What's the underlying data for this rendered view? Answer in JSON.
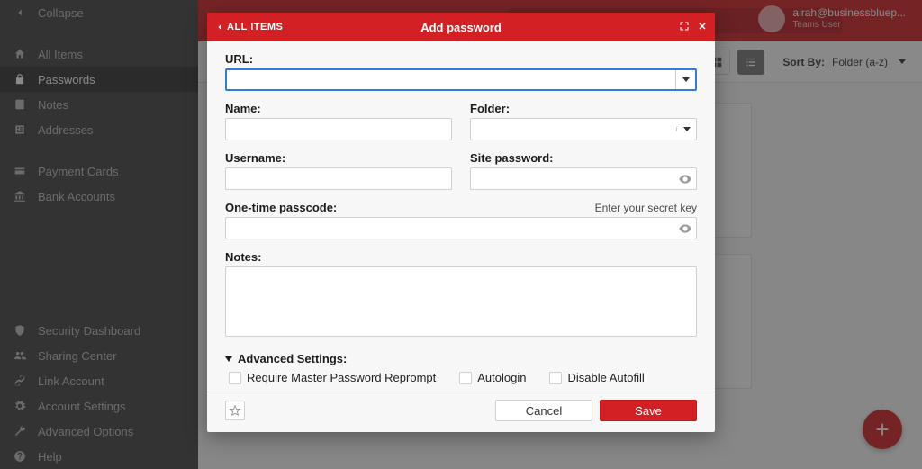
{
  "sidebar": {
    "collapse": "Collapse",
    "items": [
      {
        "label": "All Items"
      },
      {
        "label": "Passwords"
      },
      {
        "label": "Notes"
      },
      {
        "label": "Addresses"
      }
    ],
    "payment": [
      {
        "label": "Payment Cards"
      },
      {
        "label": "Bank Accounts"
      }
    ],
    "bottom": [
      {
        "label": "Security Dashboard"
      },
      {
        "label": "Sharing Center"
      },
      {
        "label": "Link Account"
      },
      {
        "label": "Account Settings"
      },
      {
        "label": "Advanced Options"
      },
      {
        "label": "Help"
      }
    ]
  },
  "header": {
    "user_email": "airah@businessbluep...",
    "user_sub": "Teams User"
  },
  "toolbar": {
    "sort_label": "Sort By:",
    "sort_value": "Folder (a-z)"
  },
  "dialog": {
    "back": "ALL ITEMS",
    "title": "Add password",
    "labels": {
      "url": "URL:",
      "name": "Name:",
      "folder": "Folder:",
      "username": "Username:",
      "sitepw": "Site password:",
      "otp": "One-time passcode:",
      "otp_hint": "Enter your secret key",
      "notes": "Notes:",
      "advanced": "Advanced Settings:",
      "req_reprompt": "Require Master Password Reprompt",
      "autologin": "Autologin",
      "disable_autofill": "Disable Autofill"
    },
    "values": {
      "url": "",
      "name": "",
      "folder": "",
      "username": "",
      "sitepw": "",
      "otp": "",
      "notes": ""
    },
    "footer": {
      "cancel": "Cancel",
      "save": "Save"
    }
  },
  "colors": {
    "brand": "#d32024"
  }
}
